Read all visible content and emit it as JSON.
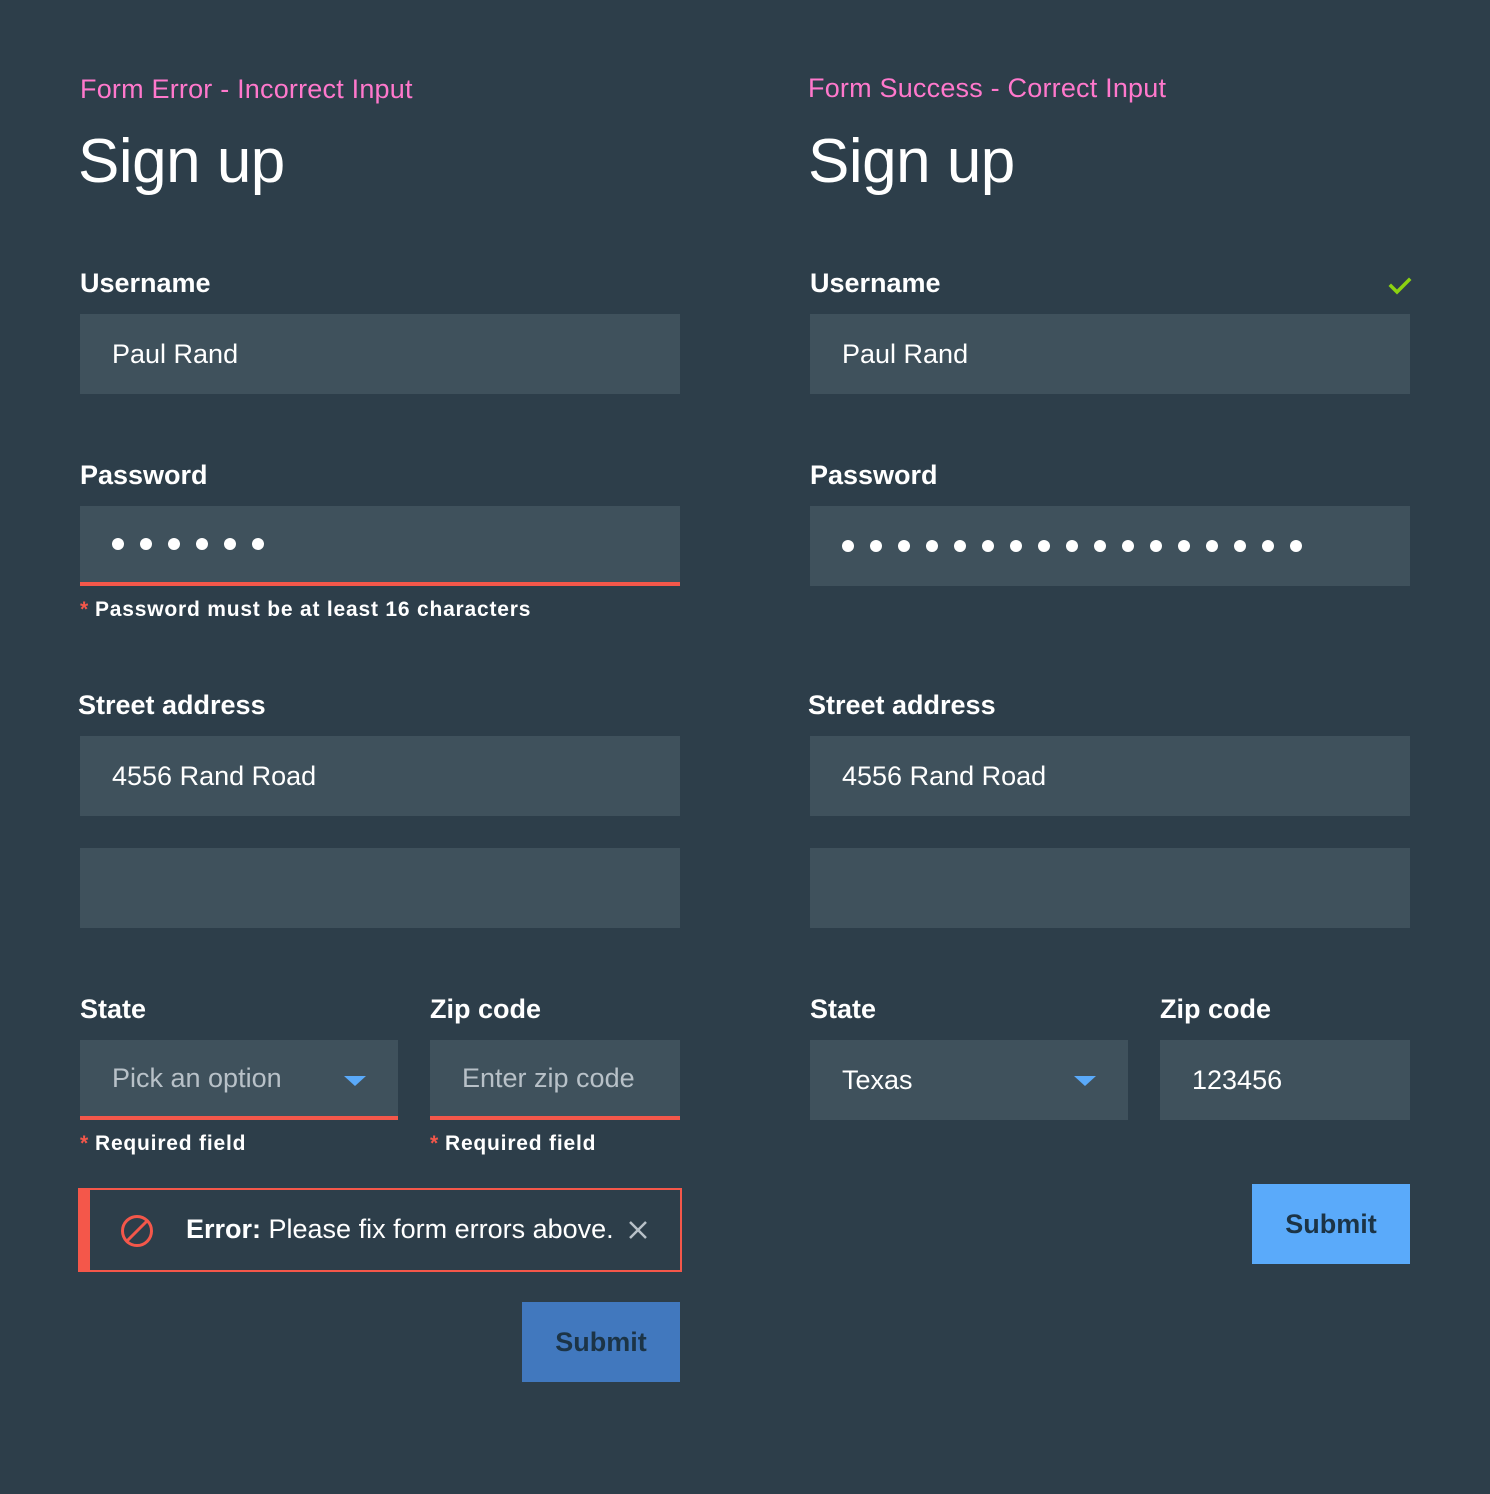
{
  "left": {
    "caption": "Form Error - Incorrect Input",
    "title": "Sign up",
    "username": {
      "label": "Username",
      "value": "Paul Rand"
    },
    "password": {
      "label": "Password",
      "masked_length": 6,
      "error": "Password must be at least 16 characters"
    },
    "street": {
      "label": "Street address",
      "line1": "4556 Rand Road",
      "line2": ""
    },
    "state": {
      "label": "State",
      "placeholder": "Pick an option",
      "error": "Required field"
    },
    "zip": {
      "label": "Zip code",
      "placeholder": "Enter zip code",
      "error": "Required field"
    },
    "alert": {
      "prefix": "Error:",
      "message": " Please fix form errors above."
    },
    "submit_label": "Submit"
  },
  "right": {
    "caption": "Form Success - Correct Input",
    "title": "Sign up",
    "username": {
      "label": "Username",
      "value": "Paul Rand",
      "valid_icon": "checkmark-icon"
    },
    "password": {
      "label": "Password",
      "masked_length": 17
    },
    "street": {
      "label": "Street address",
      "line1": "4556 Rand Road",
      "line2": ""
    },
    "state": {
      "label": "State",
      "value": "Texas"
    },
    "zip": {
      "label": "Zip code",
      "value": "123456"
    },
    "submit_label": "Submit"
  },
  "required_marker": "*",
  "colors": {
    "background": "#2d3e4a",
    "field": "#3f515c",
    "caption": "#ff78cc",
    "error": "#f4574a",
    "success": "#8cd211",
    "accent": "#5aaafa",
    "button_disabled": "#4178be"
  }
}
